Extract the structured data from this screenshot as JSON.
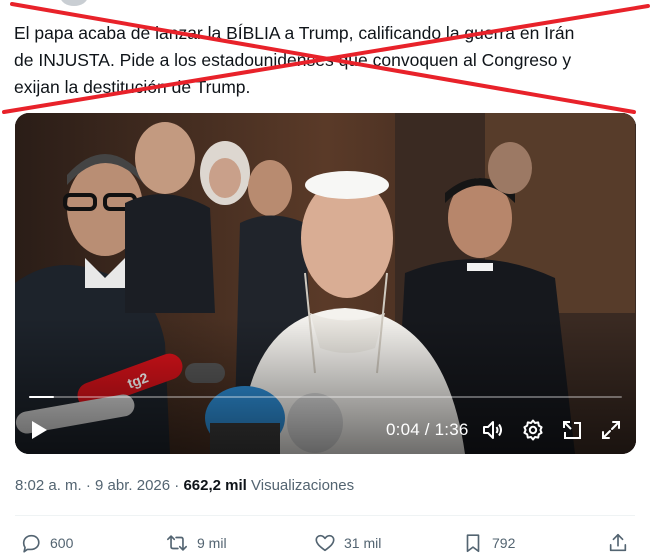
{
  "tweet": {
    "lines": [
      "El papa acaba de lanzar la BÍBLIA a Trump, calificando la guerra en Irán",
      "de INJUSTA. Pide a los estadounidenses que convoquen al Congreso y",
      "exijan la destitución de Trump."
    ]
  },
  "annotation": {
    "cross_color": "#e8222a"
  },
  "video": {
    "time": "0:04 / 1:36",
    "progress_fraction": 0.042,
    "icons": [
      "play-icon",
      "volume-icon",
      "settings-icon",
      "pip-icon",
      "fullscreen-icon"
    ]
  },
  "meta": {
    "timestamp": "8:02 a. m. · 9 abr. 2026 ·",
    "views_count": "662,2 mil",
    "views_label": "Visualizaciones"
  },
  "actions": {
    "replies": "600",
    "reposts": "9 mil",
    "likes": "31 mil",
    "bookmarks": "792"
  },
  "colors": {
    "text": "#0f1419",
    "muted": "#536471",
    "divider": "#eff3f4"
  }
}
